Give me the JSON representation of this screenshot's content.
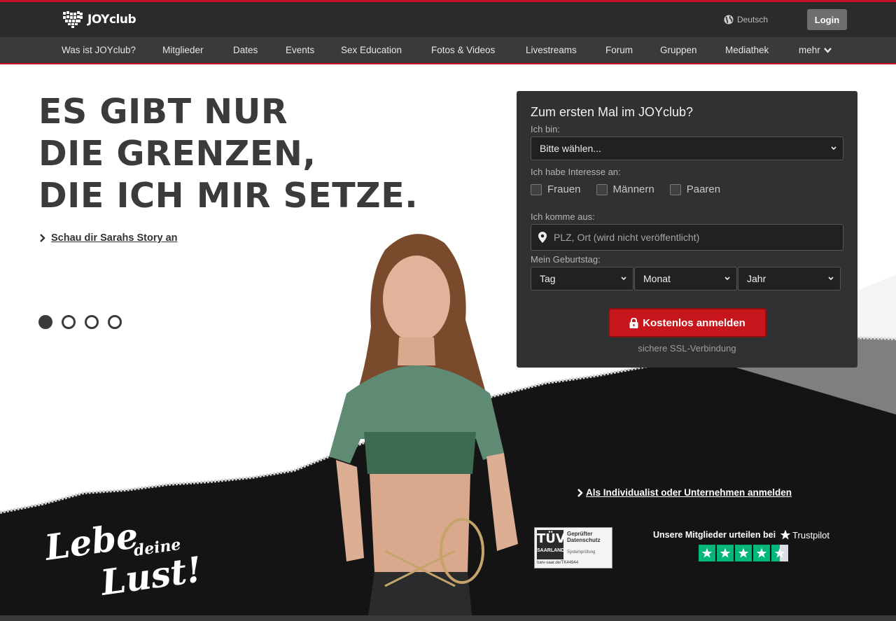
{
  "header": {
    "logo_text": "JOYclub",
    "language": "Deutsch",
    "login_label": "Login"
  },
  "nav": {
    "items": [
      "Was ist JOYclub?",
      "Mitglieder",
      "Dates",
      "Events",
      "Sex Education",
      "Fotos & Videos",
      "Livestreams",
      "Forum",
      "Gruppen",
      "Mediathek",
      "mehr"
    ]
  },
  "hero": {
    "headline_line1": "ES GIBT NUR",
    "headline_line2": "DIE GRENZEN,",
    "headline_line3": "DIE ICH MIR SETZE.",
    "story_link": "Schau dir Sarahs Story an",
    "slide_count": 4,
    "active_slide": 1
  },
  "registration": {
    "title": "Zum ersten Mal im JOYclub?",
    "i_am_label": "Ich bin:",
    "i_am_value": "Bitte wählen...",
    "interest_label": "Ich habe Interesse an:",
    "interest_options": [
      "Frauen",
      "Männern",
      "Paaren"
    ],
    "from_label": "Ich komme aus:",
    "location_placeholder": "PLZ, Ort (wird nicht veröffentlicht)",
    "birthday_label": "Mein Geburtstag:",
    "day": "Tag",
    "month": "Monat",
    "year": "Jahr",
    "submit_label": "Kostenlos anmelden",
    "ssl_note": "sichere SSL-Verbindung"
  },
  "footer_area": {
    "business_link": "Als Individualist oder Unternehmen anmelden",
    "slogan_1": "Lebe",
    "slogan_2": "deine",
    "slogan_3": "Lust!",
    "tuv_brand": "TÜV",
    "tuv_region": "SAARLAND",
    "tuv_title": "Geprüfter Datenschutz",
    "tuv_sub": "Systemprüfung",
    "tuv_id": "tuev-saar.de/TK44944",
    "trustpilot_text": "Unsere Mitglieder urteilen bei",
    "trustpilot_brand": "Trustpilot",
    "trustpilot_rating": 4.5
  },
  "colors": {
    "brand_red": "#c8102e",
    "dark_bar": "#2b2b2b",
    "trustpilot_green": "#00b67a"
  }
}
